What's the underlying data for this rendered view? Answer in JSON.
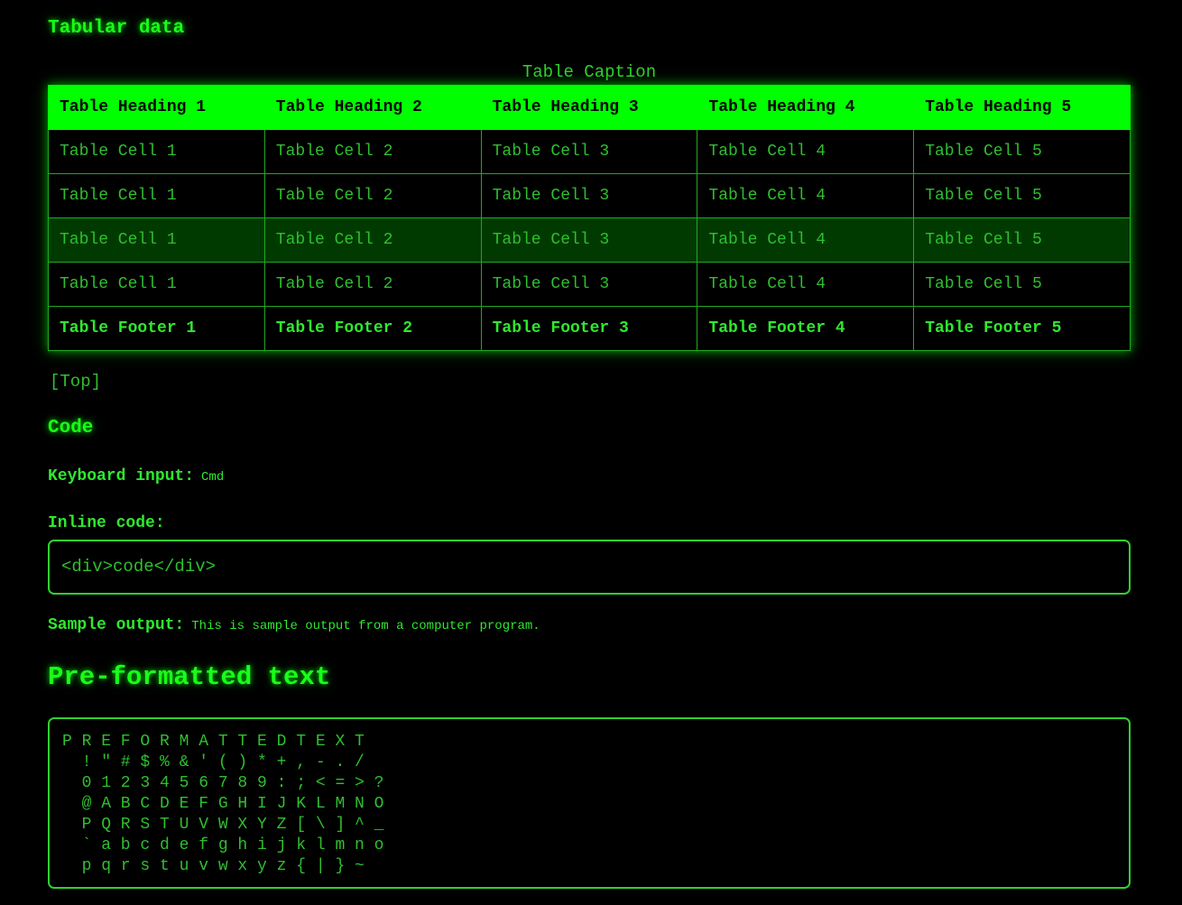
{
  "sections": {
    "tabular_title": "Tabular data",
    "code_title": "Code",
    "pre_title": "Pre-formatted text"
  },
  "table": {
    "caption": "Table Caption",
    "headers": [
      "Table Heading 1",
      "Table Heading 2",
      "Table Heading 3",
      "Table Heading 4",
      "Table Heading 5"
    ],
    "rows": [
      [
        "Table Cell 1",
        "Table Cell 2",
        "Table Cell 3",
        "Table Cell 4",
        "Table Cell 5"
      ],
      [
        "Table Cell 1",
        "Table Cell 2",
        "Table Cell 3",
        "Table Cell 4",
        "Table Cell 5"
      ],
      [
        "Table Cell 1",
        "Table Cell 2",
        "Table Cell 3",
        "Table Cell 4",
        "Table Cell 5"
      ],
      [
        "Table Cell 1",
        "Table Cell 2",
        "Table Cell 3",
        "Table Cell 4",
        "Table Cell 5"
      ]
    ],
    "highlighted_row": 2,
    "footers": [
      "Table Footer 1",
      "Table Footer 2",
      "Table Footer 3",
      "Table Footer 4",
      "Table Footer 5"
    ]
  },
  "top_link": "[Top]",
  "code": {
    "keyboard_label": "Keyboard input:",
    "keyboard_value": "Cmd",
    "inline_label": "Inline code:",
    "inline_value": "<div>code</div>",
    "sample_label": "Sample output:",
    "sample_value": "This is sample output from a computer program."
  },
  "pre_text": "P R E F O R M A T T E D T E X T\n  ! \" # $ % & ' ( ) * + , - . /\n  0 1 2 3 4 5 6 7 8 9 : ; < = > ?\n  @ A B C D E F G H I J K L M N O\n  P Q R S T U V W X Y Z [ \\ ] ^ _\n  ` a b c d e f g h i j k l m n o\n  p q r s t u v w x y z { | } ~",
  "colors": {
    "background": "#000000",
    "text": "#2fd12f",
    "accent": "#00ff00",
    "highlight_row": "#013a01"
  }
}
